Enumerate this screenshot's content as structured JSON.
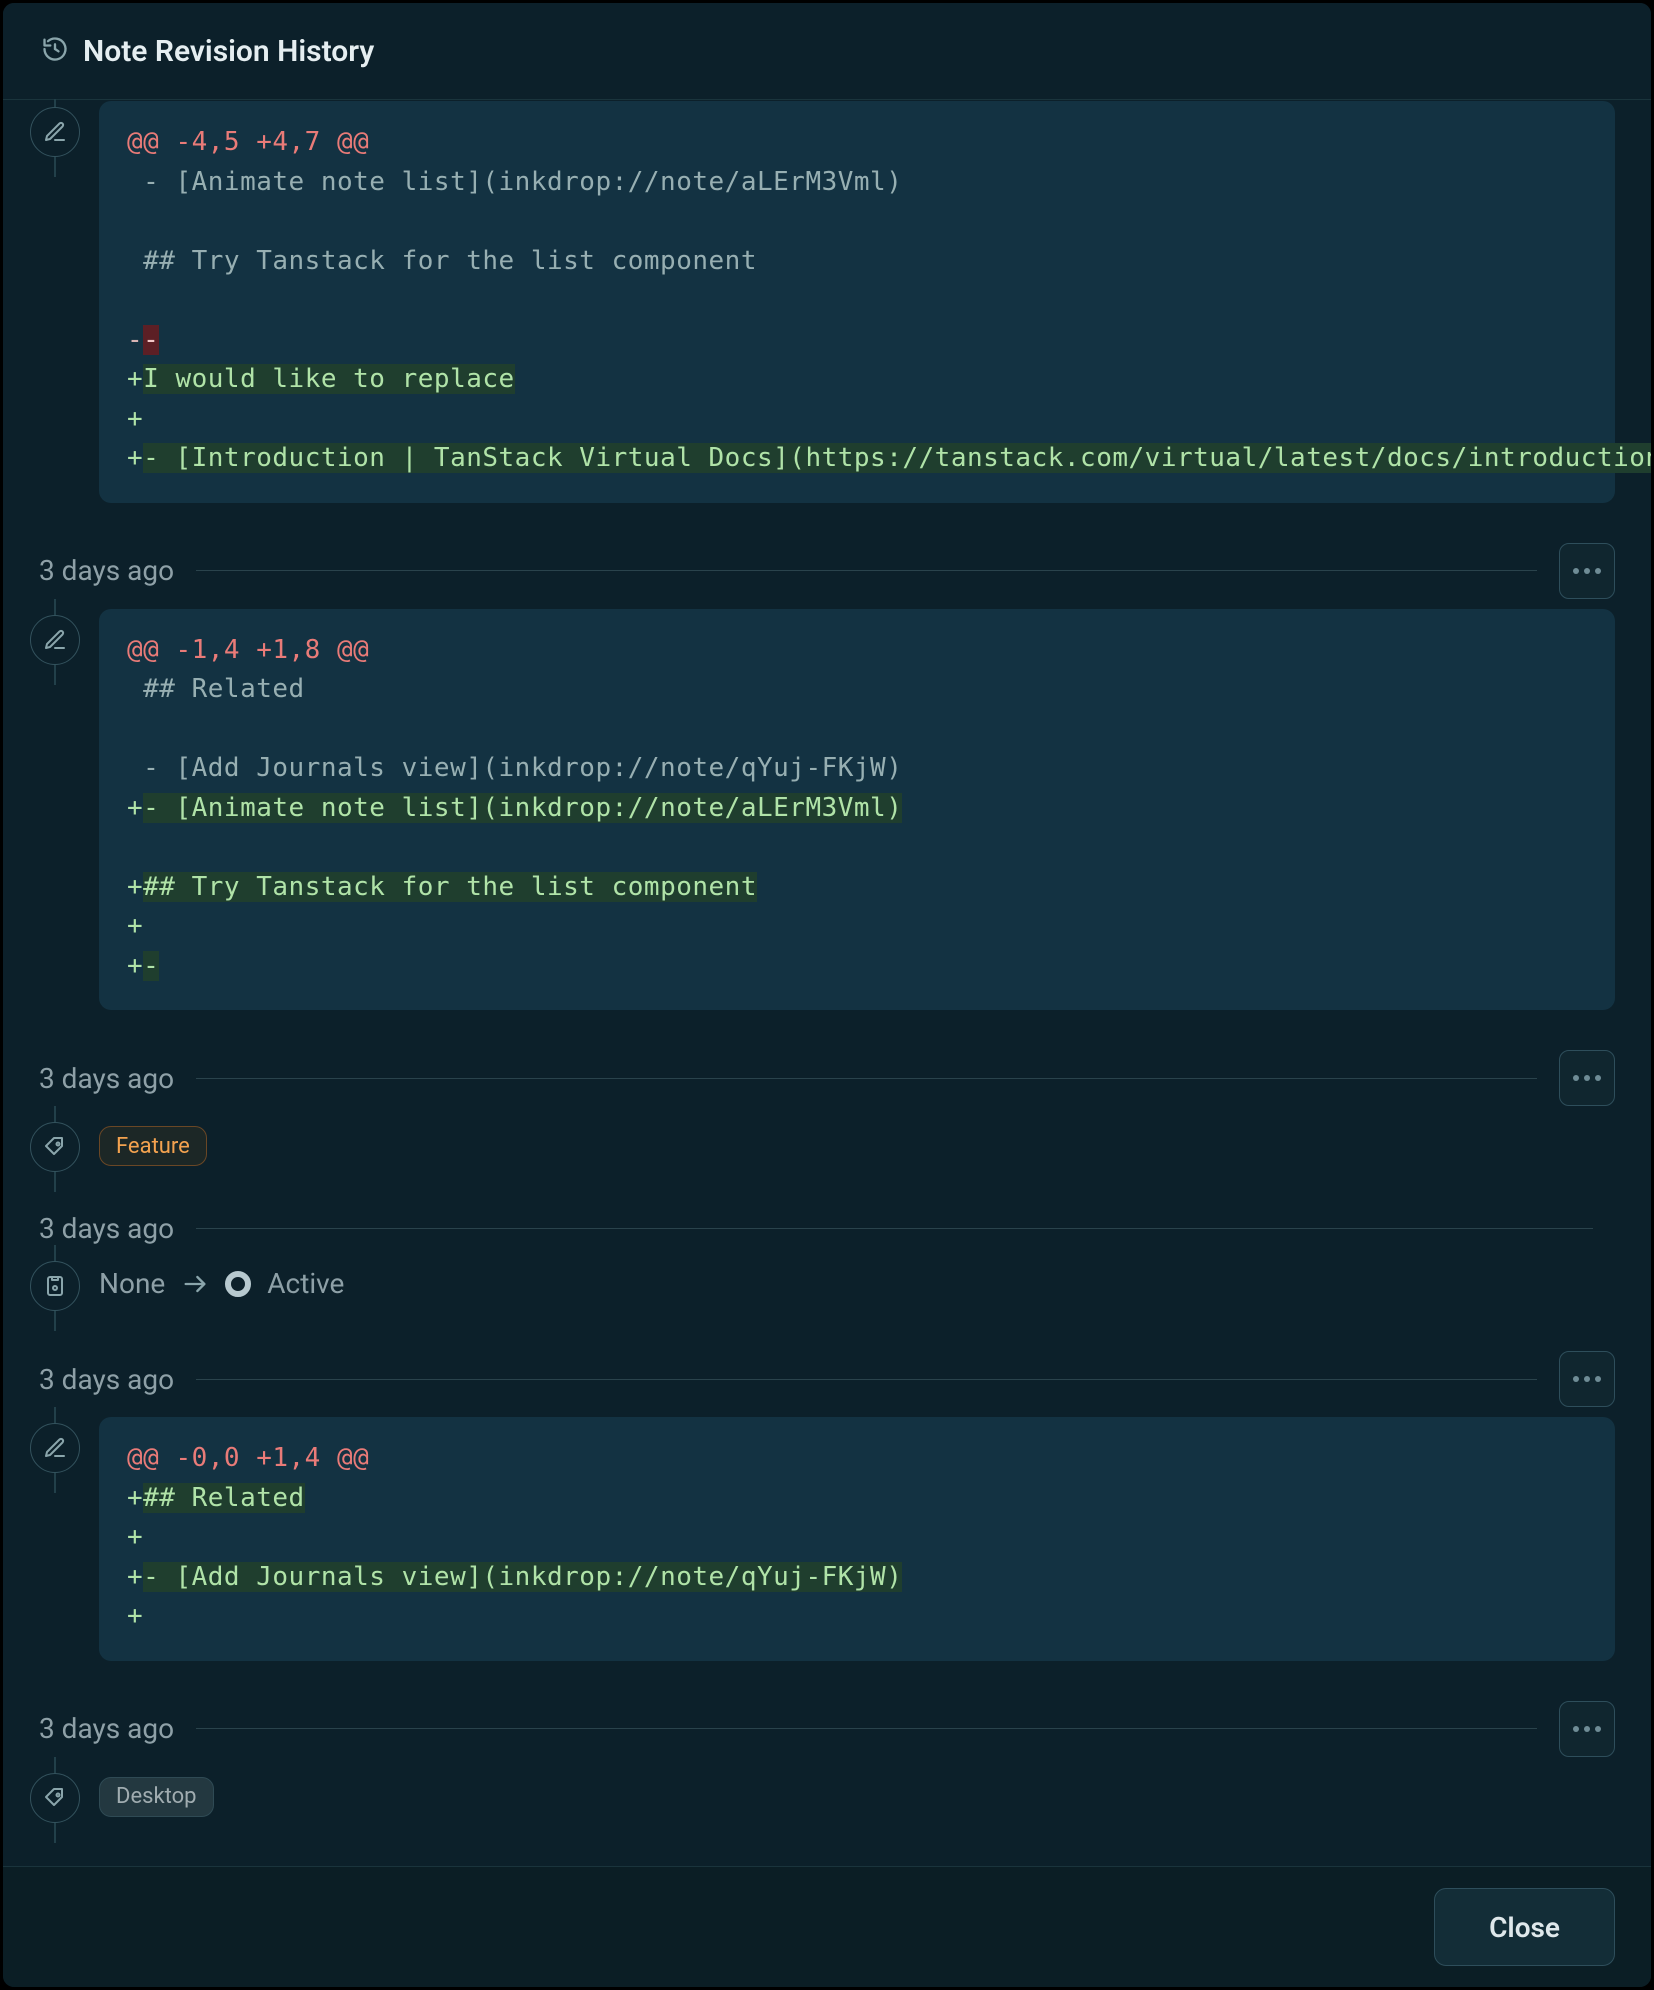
{
  "header": {
    "title": "Note Revision History"
  },
  "revisions": [
    {
      "kind": "diff",
      "icon": "edit-icon",
      "diff": {
        "lines": [
          {
            "type": "hunk",
            "text": "@@ -4,5 +4,7 @@"
          },
          {
            "type": "ctx",
            "text": " - [Animate note list](inkdrop://note/aLErM3Vml)"
          },
          {
            "type": "ctx",
            "text": " "
          },
          {
            "type": "ctx",
            "text": " ## Try Tanstack for the list component"
          },
          {
            "type": "ctx",
            "text": " "
          },
          {
            "type": "del",
            "marker": "-",
            "text": "-",
            "hl": true
          },
          {
            "type": "add",
            "marker": "+",
            "text": "I would like to replace",
            "hl": true
          },
          {
            "type": "add",
            "marker": "+",
            "text": "",
            "hl": false
          },
          {
            "type": "add",
            "marker": "+",
            "text": "- [Introduction | TanStack Virtual Docs](https://tanstack.com/virtual/latest/docs/introduction)",
            "hl": true
          }
        ]
      }
    },
    {
      "timestamp": "3 days ago",
      "kind": "diff",
      "icon": "edit-icon",
      "diff": {
        "lines": [
          {
            "type": "hunk",
            "text": "@@ -1,4 +1,8 @@"
          },
          {
            "type": "ctx",
            "text": " ## Related"
          },
          {
            "type": "ctx",
            "text": " "
          },
          {
            "type": "ctx",
            "text": " - [Add Journals view](inkdrop://note/qYuj-FKjW)"
          },
          {
            "type": "add",
            "marker": "+",
            "text": "- [Animate note list](inkdrop://note/aLErM3Vml)",
            "hl": true
          },
          {
            "type": "ctx",
            "text": " "
          },
          {
            "type": "add",
            "marker": "+",
            "text": "## Try Tanstack for the list component",
            "hl": true
          },
          {
            "type": "add",
            "marker": "+",
            "text": "",
            "hl": false
          },
          {
            "type": "add",
            "marker": "+",
            "text": "-",
            "hl": true
          }
        ]
      }
    },
    {
      "timestamp": "3 days ago",
      "kind": "tag",
      "icon": "tag-icon",
      "tag": {
        "style": "orange",
        "label": "Feature"
      }
    },
    {
      "timestamp": "3 days ago",
      "kind": "status",
      "icon": "status-icon",
      "status": {
        "from": "None",
        "to": "Active"
      }
    },
    {
      "timestamp": "3 days ago",
      "kind": "diff",
      "icon": "edit-icon",
      "diff": {
        "lines": [
          {
            "type": "hunk",
            "text": "@@ -0,0 +1,4 @@"
          },
          {
            "type": "add",
            "marker": "+",
            "text": "## Related",
            "hl": true
          },
          {
            "type": "add",
            "marker": "+",
            "text": "",
            "hl": false
          },
          {
            "type": "add",
            "marker": "+",
            "text": "- [Add Journals view](inkdrop://note/qYuj-FKjW)",
            "hl": true
          },
          {
            "type": "add",
            "marker": "+",
            "text": "",
            "hl": false
          }
        ]
      }
    },
    {
      "timestamp": "3 days ago",
      "kind": "tag",
      "icon": "tag-icon",
      "tag": {
        "style": "gray",
        "label": "Desktop"
      }
    }
  ],
  "footer": {
    "close_label": "Close"
  },
  "icons": {
    "history": "history-icon",
    "edit": "edit-icon",
    "tag": "tag-icon",
    "status": "status-icon",
    "arrow": "arrow-right-icon",
    "dot": "status-dot-icon",
    "more": "more-icon"
  }
}
